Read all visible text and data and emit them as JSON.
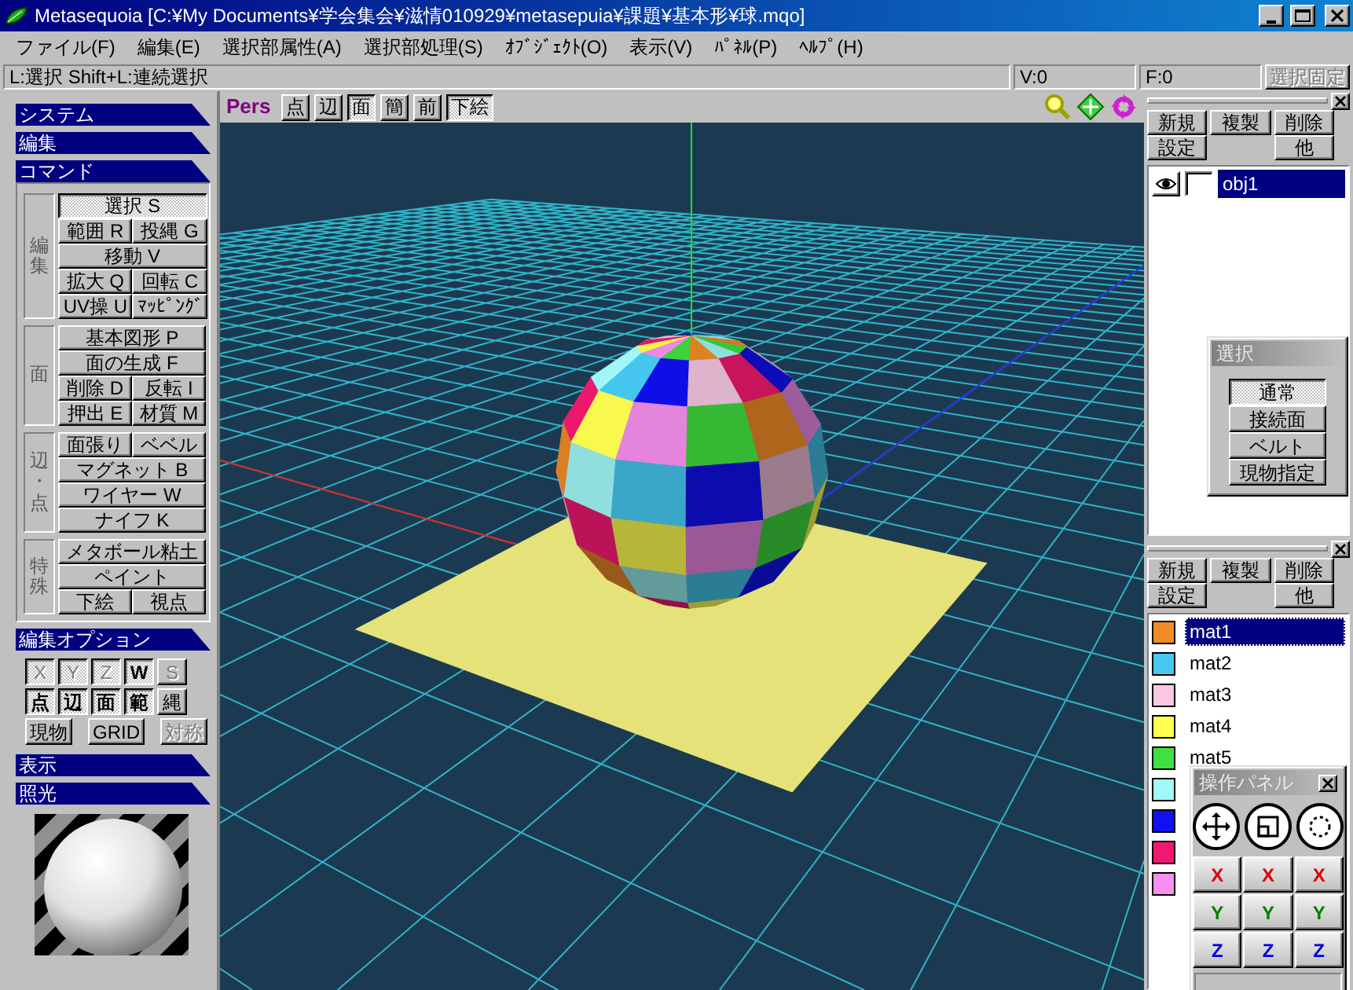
{
  "window": {
    "title": "Metasequoia [C:¥My Documents¥学会集会¥滋情010929¥metasepuia¥課題¥基本形¥球.mqo]"
  },
  "menu": [
    "ファイル(F)",
    "編集(E)",
    "選択部属性(A)",
    "選択部処理(S)",
    "ｵﾌﾞｼﾞｪｸﾄ(O)",
    "表示(V)",
    "ﾊﾟﾈﾙ(P)",
    "ﾍﾙﾌﾟ(H)"
  ],
  "status_bar": {
    "hint": "L:選択  Shift+L:連続選択",
    "vertex_count": "V:0",
    "face_count": "F:0",
    "lock_selection": {
      "label": "選択固定",
      "disabled": true
    }
  },
  "left_panel": {
    "sections_top": [
      {
        "title": "システム"
      },
      {
        "title": "編集"
      }
    ],
    "command": {
      "title": "コマンド",
      "groups": [
        {
          "label": "編集",
          "rows": [
            [
              {
                "label": "選択 S",
                "selected": true
              }
            ],
            [
              {
                "label": "範囲 R",
                "selected": false
              },
              {
                "label": "投縄 G",
                "selected": false
              }
            ],
            [
              {
                "label": "移動 V",
                "selected": false
              }
            ],
            [
              {
                "label": "拡大 Q",
                "selected": false
              },
              {
                "label": "回転 C",
                "selected": false
              }
            ],
            [
              {
                "label": "UV操 U",
                "selected": false
              },
              {
                "label": "ﾏｯﾋﾟﾝｸﾞ",
                "selected": false
              }
            ]
          ]
        },
        {
          "label": "面",
          "rows": [
            [
              {
                "label": "基本図形 P",
                "selected": false
              }
            ],
            [
              {
                "label": "面の生成 F",
                "selected": false
              }
            ],
            [
              {
                "label": "削除 D",
                "selected": false
              },
              {
                "label": "反転 I",
                "selected": false
              }
            ],
            [
              {
                "label": "押出 E",
                "selected": false
              },
              {
                "label": "材質 M",
                "selected": false
              }
            ]
          ]
        },
        {
          "label": "辺・点",
          "rows": [
            [
              {
                "label": "面張り",
                "selected": false
              },
              {
                "label": "ベベル",
                "selected": false
              }
            ],
            [
              {
                "label": "マグネット B",
                "selected": false
              }
            ],
            [
              {
                "label": "ワイヤー W",
                "selected": false
              }
            ],
            [
              {
                "label": "ナイフ K",
                "selected": false
              }
            ]
          ]
        },
        {
          "label": "特殊",
          "rows": [
            [
              {
                "label": "メタボール粘土",
                "selected": false
              }
            ],
            [
              {
                "label": "ペイント",
                "selected": false
              }
            ],
            [
              {
                "label": "下絵",
                "selected": false
              },
              {
                "label": "視点",
                "selected": false
              }
            ]
          ]
        }
      ]
    },
    "edit_options": {
      "title": "編集オプション",
      "axis_toggles": [
        {
          "label": "X",
          "pressed": true,
          "disabled": true
        },
        {
          "label": "Y",
          "pressed": true,
          "disabled": true
        },
        {
          "label": "Z",
          "pressed": true,
          "disabled": true
        },
        {
          "label": "W",
          "pressed": true,
          "disabled": false
        },
        {
          "label": "S",
          "pressed": false,
          "disabled": true
        }
      ],
      "element_toggles": [
        {
          "label": "点",
          "pressed": true,
          "disabled": false
        },
        {
          "label": "辺",
          "pressed": true,
          "disabled": false
        },
        {
          "label": "面",
          "pressed": true,
          "disabled": false
        },
        {
          "label": "範",
          "pressed": true,
          "disabled": false
        },
        {
          "label": "縄",
          "pressed": false,
          "disabled": false
        }
      ],
      "extra_toggles": [
        {
          "label": "現物",
          "pressed": false,
          "disabled": false
        },
        {
          "label": "GRID",
          "pressed": false,
          "disabled": false
        },
        {
          "label": "対称",
          "pressed": false,
          "disabled": true
        }
      ]
    },
    "sections_bottom": [
      {
        "title": "表示"
      },
      {
        "title": "照光"
      }
    ]
  },
  "viewport": {
    "view_label": "Pers",
    "toolbar": [
      {
        "label": "点",
        "pressed": false
      },
      {
        "label": "辺",
        "pressed": false
      },
      {
        "label": "面",
        "pressed": true
      },
      {
        "label": "簡",
        "pressed": false
      },
      {
        "label": "前",
        "pressed": false
      },
      {
        "label": "下絵",
        "pressed": true
      }
    ]
  },
  "object_panel": {
    "buttons_row1": [
      "新規",
      "複製",
      "削除"
    ],
    "buttons_row2": [
      "設定",
      "他"
    ],
    "objects": [
      {
        "name": "obj1",
        "visible": true,
        "selected": true
      }
    ]
  },
  "select_panel": {
    "title": "選択",
    "options": [
      {
        "label": "通常",
        "selected": true
      },
      {
        "label": "接続面",
        "selected": false
      },
      {
        "label": "ベルト",
        "selected": false
      },
      {
        "label": "現物指定",
        "selected": false
      }
    ]
  },
  "material_panel": {
    "buttons_row1": [
      "新規",
      "複製",
      "削除"
    ],
    "buttons_row2": [
      "設定",
      "他"
    ],
    "materials": [
      {
        "name": "mat1",
        "color": "#f08c28",
        "selected": true
      },
      {
        "name": "mat2",
        "color": "#46c8f0",
        "selected": false
      },
      {
        "name": "mat3",
        "color": "#f8c8e4",
        "selected": false
      },
      {
        "name": "mat4",
        "color": "#ffff50",
        "selected": false
      },
      {
        "name": "mat5",
        "color": "#40e040",
        "selected": false
      },
      {
        "color": "#a0f8f8",
        "selected": false
      },
      {
        "color": "#1010f0",
        "selected": false
      },
      {
        "color": "#f01870",
        "selected": false
      },
      {
        "color": "#f890f0",
        "selected": false
      }
    ]
  },
  "operation_panel": {
    "title": "操作パネル",
    "tools": [
      {
        "kind": "move"
      },
      {
        "kind": "scale"
      },
      {
        "kind": "rotate"
      }
    ],
    "axis_rows": [
      {
        "color": "#e00000",
        "buttons": [
          "X",
          "X",
          "X"
        ]
      },
      {
        "color": "#008000",
        "buttons": [
          "Y",
          "Y",
          "Y"
        ]
      },
      {
        "color": "#0000e0",
        "buttons": [
          "Z",
          "Z",
          "Z"
        ]
      }
    ]
  }
}
